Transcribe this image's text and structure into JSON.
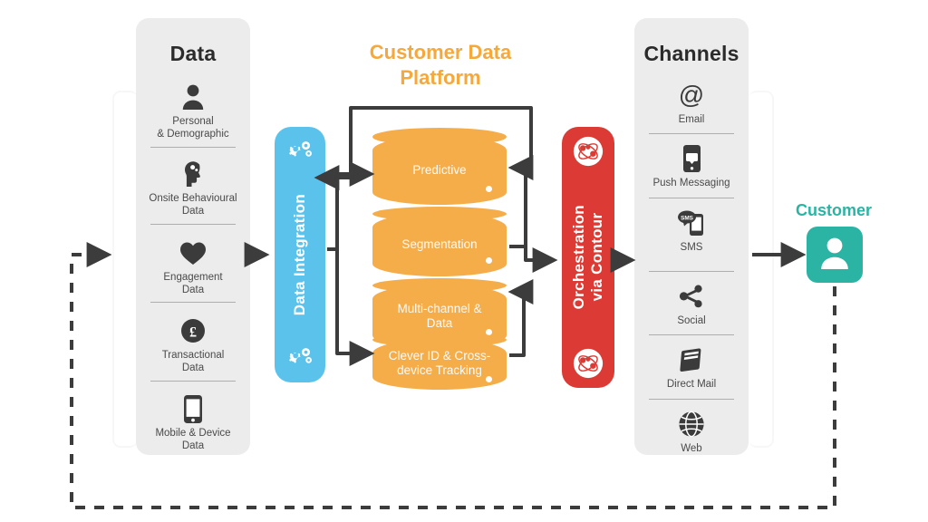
{
  "title": "Customer Data Platform",
  "colors": {
    "orange": "#F5AD4A",
    "orange_text": "#F5A83C",
    "blue": "#5BC2EC",
    "red": "#DC3B35",
    "teal": "#2BB3A3",
    "panel_grey": "#ECECEC",
    "line_dark": "#3C3C3C"
  },
  "data_panel": {
    "title": "Data",
    "items": [
      {
        "icon": "person-icon",
        "label": "Personal\n& Demographic"
      },
      {
        "icon": "brain-head-icon",
        "label": "Onsite Behavioural\nData"
      },
      {
        "icon": "heart-icon",
        "label": "Engagement\nData"
      },
      {
        "icon": "pound-coin-icon",
        "label": "Transactional\nData"
      },
      {
        "icon": "mobile-phone-icon",
        "label": "Mobile & Device\nData"
      }
    ]
  },
  "channels_panel": {
    "title": "Channels",
    "items": [
      {
        "icon": "at-sign-icon",
        "label": "Email"
      },
      {
        "icon": "push-notification-icon",
        "label": "Push Messaging"
      },
      {
        "icon": "sms-icon",
        "label": "SMS"
      },
      {
        "icon": "share-icon",
        "label": "Social"
      },
      {
        "icon": "book-mail-icon",
        "label": "Direct Mail"
      },
      {
        "icon": "globe-icon",
        "label": "Web"
      }
    ]
  },
  "integration_bar": {
    "label": "Data Integration",
    "icon_top": "gears-icon",
    "icon_bottom": "gears-icon"
  },
  "orchestration_bar": {
    "label": "Orchestration\nvia Contour",
    "icon_top": "atom-icon",
    "icon_bottom": "atom-icon"
  },
  "cylinders": [
    {
      "label": "Predictive"
    },
    {
      "label": "Segmentation"
    },
    {
      "label": "Multi-channel &\nData"
    },
    {
      "label": "Clever ID & Cross-\ndevice Tracking"
    }
  ],
  "customer": {
    "label": "Customer",
    "icon": "customer-avatar-icon"
  }
}
